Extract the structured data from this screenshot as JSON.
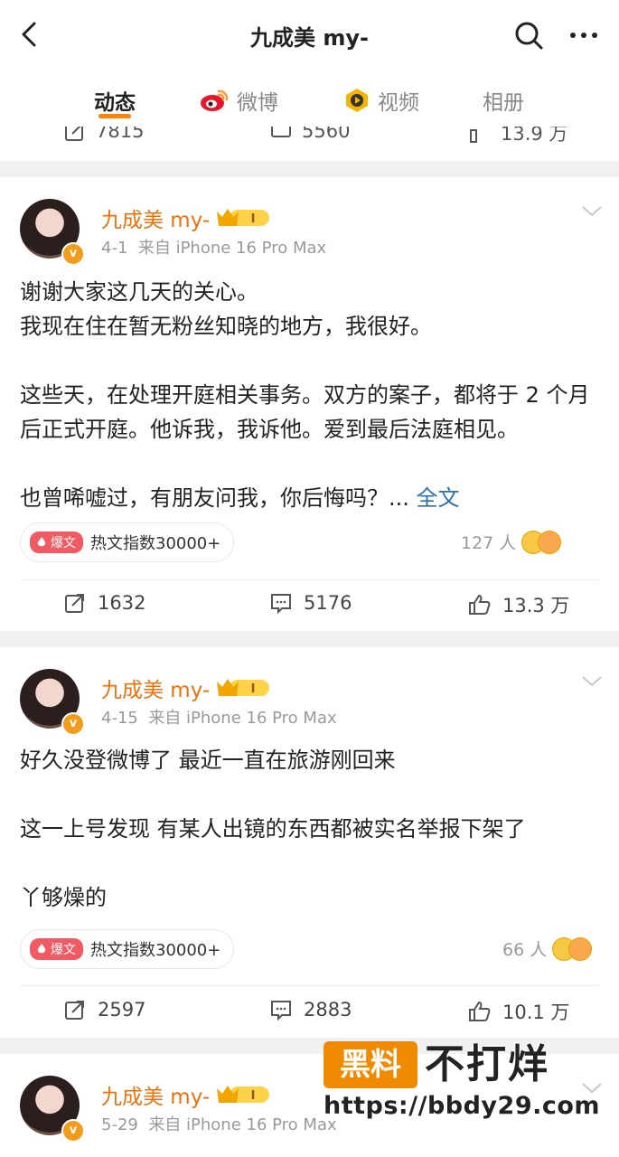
{
  "header": {
    "title": "九成美 my-"
  },
  "tabs": [
    {
      "label": "动态"
    },
    {
      "label": "微博"
    },
    {
      "label": "视频"
    },
    {
      "label": "相册"
    }
  ],
  "prev_actions": {
    "reposts": "7815",
    "comments": "5560",
    "likes": "13.9 万"
  },
  "posts": [
    {
      "username": "九成美 my-",
      "level_badge": "I",
      "date": "4-1",
      "source": "来自 iPhone 16 Pro Max",
      "lines": "谢谢大家这几天的关心。\n我现在住在暂无粉丝知晓的地方，我很好。\n\n这些天，在处理开庭相关事务。双方的案子，都将于 2 个月后正式开庭。他诉我，我诉他。爱到最后法庭相见。\n\n也曾唏嘘过，有朋友问我，你后悔吗？... ",
      "full_text_label": "全文",
      "hot_tag": "爆文",
      "hot_label": "热文指数30000+",
      "likers": "127 人",
      "reposts": "1632",
      "comments": "5176",
      "likes": "13.3 万"
    },
    {
      "username": "九成美 my-",
      "level_badge": "I",
      "date": "4-15",
      "source": "来自 iPhone 16 Pro Max",
      "lines": "好久没登微博了 最近一直在旅游刚回来\n\n这一上号发现 有某人出镜的东西都被实名举报下架了\n\n丫够燥的",
      "hot_tag": "爆文",
      "hot_label": "热文指数30000+",
      "likers": "66 人",
      "reposts": "2597",
      "comments": "2883",
      "likes": "10.1 万"
    },
    {
      "username": "九成美 my-",
      "level_badge": "I",
      "date": "5-29",
      "source": "来自 iPhone 16 Pro Max"
    }
  ],
  "watermark": {
    "box": "黑料",
    "big": "不打烊",
    "url": "https://bbdy29.com"
  },
  "colors": {
    "accent": "#ff8200",
    "username": "#e8720c",
    "link": "#2c6fb0",
    "hot": "#f05a63"
  }
}
